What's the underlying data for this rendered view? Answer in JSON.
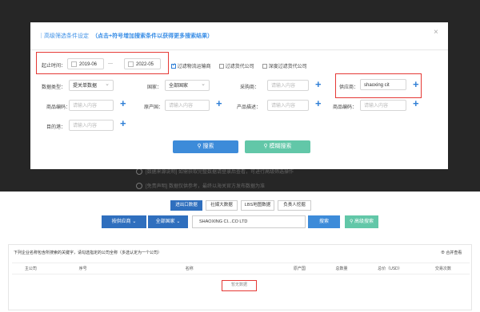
{
  "modal": {
    "title": "高级筛选条件设定",
    "hint": "（点击+符号增加搜索条件以获得更多搜索结果）",
    "close": "×",
    "row1": {
      "period_label": "起止时间：",
      "date_from": "2019-06",
      "date_sep": "—",
      "date_to": "2022-05",
      "checks": [
        {
          "label": "过滤物流运输商",
          "checked": true
        },
        {
          "label": "过滤货代公司",
          "checked": false
        },
        {
          "label": "深度过滤货代公司",
          "checked": false
        }
      ]
    },
    "row2": {
      "data_type_label": "数据类型：",
      "data_type_value": "提关单数据",
      "country_label": "国家：",
      "country_value": "全部国家",
      "buyer_label": "采购商：",
      "buyer_placeholder": "请输入内容",
      "supplier_label": "供应商：",
      "supplier_value": "shaoxing  cit"
    },
    "row3": {
      "hs_label": "商品编码：",
      "hs_placeholder": "请输入内容",
      "origin_label": "原产国：",
      "origin_placeholder": "请输入内容",
      "desc_label": "产品描述：",
      "desc_placeholder": "请输入内容",
      "product_code_label": "商品编码：",
      "product_code_placeholder": "请输入内容"
    },
    "row4": {
      "dest_label": "目的港：",
      "dest_placeholder": "请输入内容"
    },
    "search_button": "搜索",
    "fuzzy_button": "模糊搜索",
    "plus": "+"
  },
  "background": {
    "faded_line1": "[数据来源说明] 如需获取完整数据请登录后查看，可进行高级筛选操作",
    "faded_line2": "[免责声明] 数据仅供参考，最终以海关官方发布数据为准"
  },
  "page": {
    "tabs": [
      "进出口数据",
      "社媒大数据",
      "LBS地图数据",
      "负责人挖掘"
    ],
    "active_tab": 0,
    "search_type": "按供应商",
    "country": "全部国家",
    "query_value": "SHAOXING CI...CO LTD",
    "search_button": "搜索",
    "advanced_button": "高级搜索",
    "notice": "下列企业名称包含所搜索的关键字，请勾选指定的公司全称（多选认定为一个公司）",
    "merge_link": "合并查看",
    "table": {
      "columns": [
        "主公司",
        "",
        "序号",
        "名称",
        "原产国",
        "总数量",
        "总价（USD）",
        "交易次数"
      ],
      "empty_text": "暂无数据"
    }
  }
}
